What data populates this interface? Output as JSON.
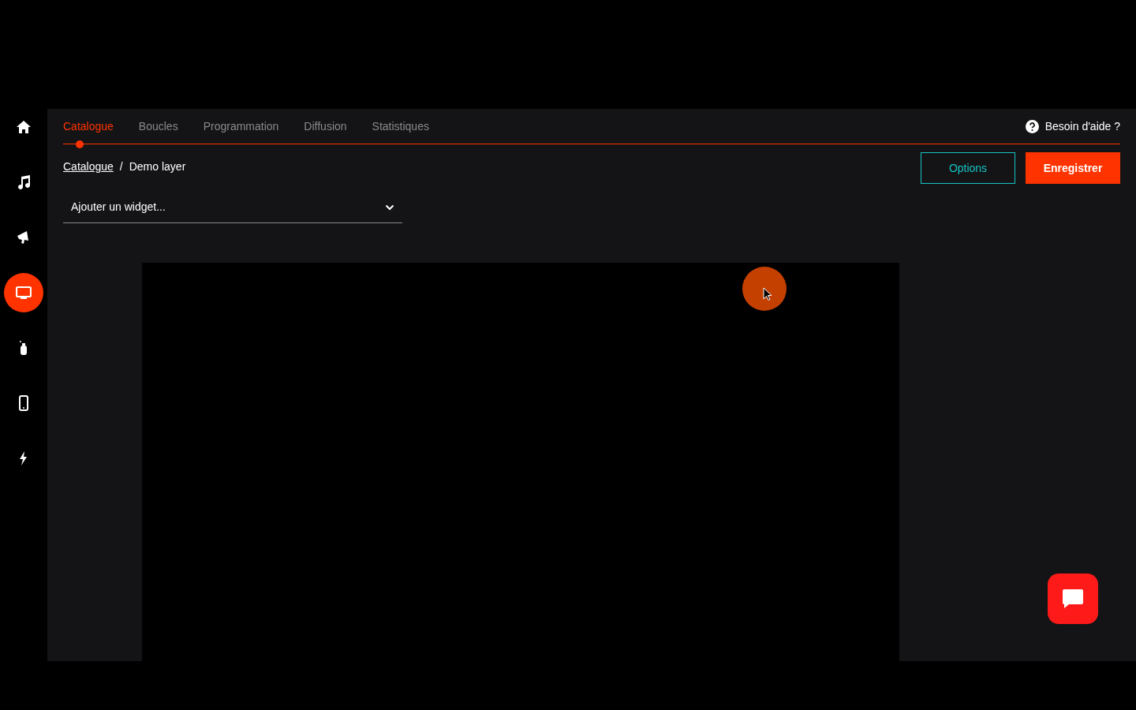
{
  "sidebar": {
    "items": [
      {
        "selected": false
      },
      {
        "selected": false
      },
      {
        "selected": false
      },
      {
        "selected": true
      },
      {
        "selected": false
      },
      {
        "selected": false
      },
      {
        "selected": false
      }
    ]
  },
  "tabs": [
    {
      "label": "Catalogue",
      "selected": true
    },
    {
      "label": "Boucles",
      "selected": false
    },
    {
      "label": "Programmation",
      "selected": false
    },
    {
      "label": "Diffusion",
      "selected": false
    },
    {
      "label": "Statistiques",
      "selected": false
    }
  ],
  "help": {
    "label": "Besoin d'aide ?"
  },
  "breadcrumb": [
    {
      "label": "Catalogue",
      "link": true
    },
    {
      "label": "Demo layer",
      "link": false
    }
  ],
  "breadcrumb_separator": "/",
  "buttons": [
    {
      "label": "Options",
      "kind": "outline"
    },
    {
      "label": "Enregistrer",
      "kind": "primary"
    }
  ],
  "widget_select": {
    "value": "Ajouter un widget..."
  }
}
